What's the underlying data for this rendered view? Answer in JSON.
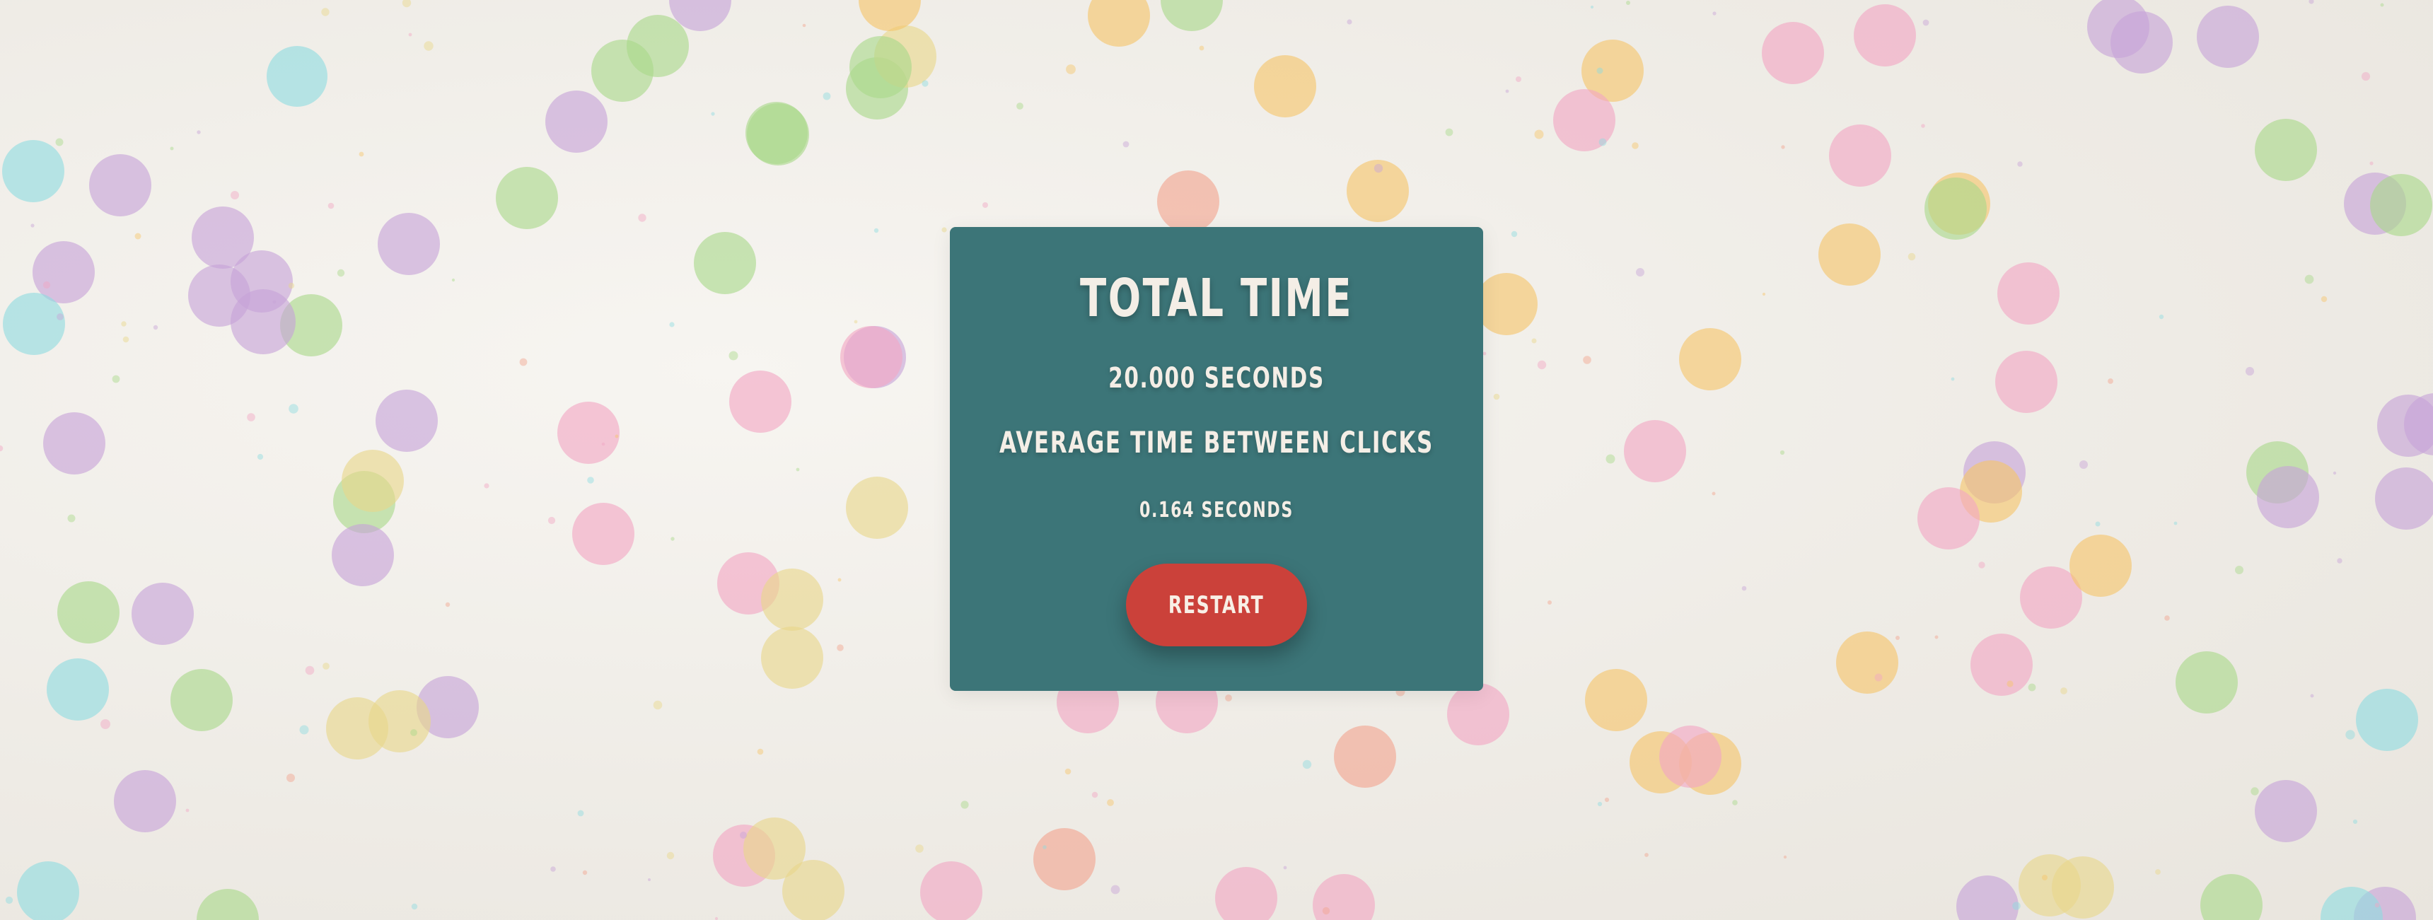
{
  "modal": {
    "title": "TOTAL TIME",
    "total_value": "20.000 SECONDS",
    "avg_label": "AVERAGE TIME BETWEEN CLICKS",
    "avg_value": "0.164 SECONDS",
    "restart_label": "RESTART"
  },
  "colors": {
    "modal_bg": "#3c7578",
    "button_bg": "#cb413a",
    "text": "#f4eee6",
    "page_bg": "#f3f1ec",
    "confetti": [
      "#f2a7c3",
      "#8fdbe0",
      "#c7a3d8",
      "#f6c56b",
      "#a9d98a",
      "#f2a48f",
      "#e8d68a"
    ]
  }
}
